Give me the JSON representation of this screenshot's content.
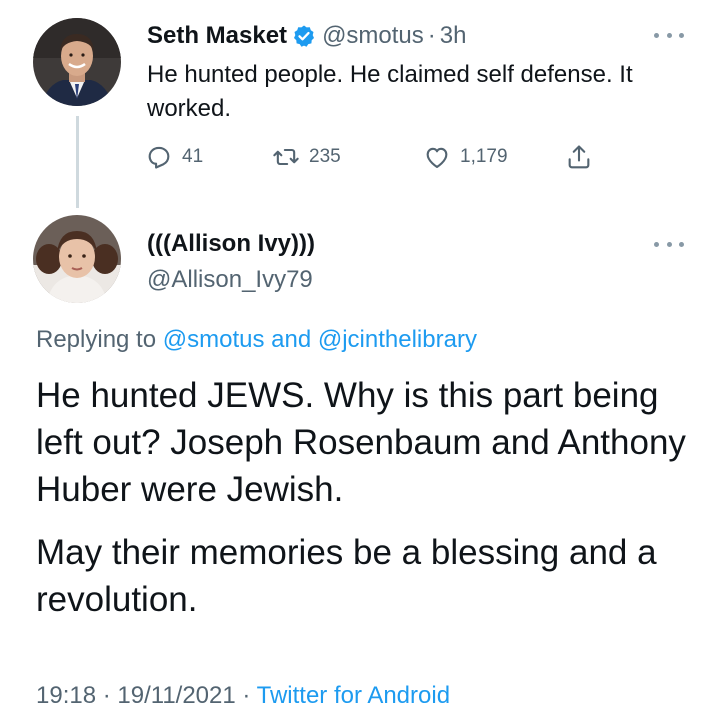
{
  "tweet1": {
    "name": "Seth Masket",
    "handle": "@smotus",
    "separator": "·",
    "time": "3h",
    "text": "He hunted people. He claimed self defense. It worked.",
    "reply_count": "41",
    "retweet_count": "235",
    "like_count": "1,179"
  },
  "tweet2": {
    "name": "(((Allison Ivy)))",
    "handle": "@Allison_Ivy79",
    "replying_prefix": "Replying to",
    "replying_user1": "@smotus",
    "replying_and": "and",
    "replying_user2": "@jcinthelibrary",
    "paragraph1": "He hunted JEWS. Why is this part being left out? Joseph Rosenbaum and Anthony Huber were Jewish.",
    "paragraph2": "May their memories be a blessing and a revolution.",
    "timestamp": "19:18 · 19/11/2021 ·",
    "source": "Twitter for Android"
  },
  "colors": {
    "text_primary": "#0f1419",
    "text_secondary": "#536471",
    "link": "#1d9bf0",
    "thread_line": "#cfd9de"
  },
  "icons": [
    "verified-badge-icon",
    "more-icon",
    "reply-icon",
    "retweet-icon",
    "like-icon",
    "share-icon"
  ]
}
